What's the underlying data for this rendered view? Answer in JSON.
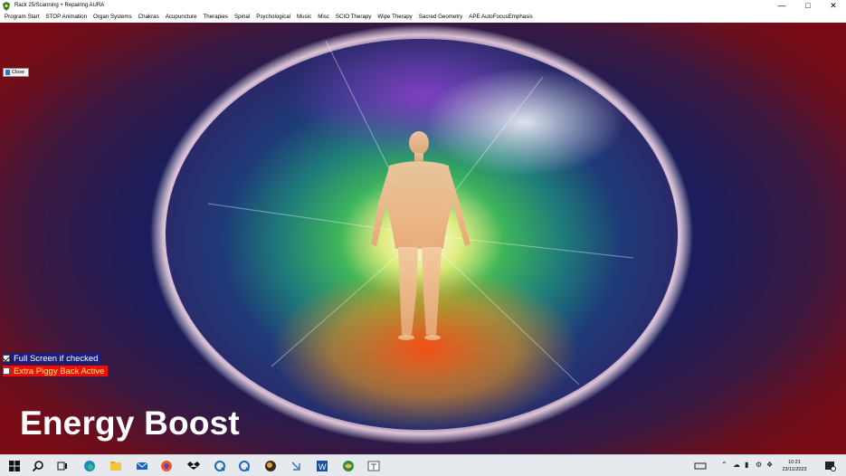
{
  "window": {
    "title": "Rack 25/Scanning + Repairing AURA",
    "controls": {
      "minimize": "—",
      "maximize": "□",
      "close": "✕"
    }
  },
  "menu": {
    "items": [
      "Program Start",
      "STOP Animation",
      "Organ Systems",
      "Chakras",
      "Acupuncture",
      "Therapies",
      "Spinal",
      "Psychological",
      "Music",
      "Misc",
      "SCIO Therapy",
      "Wipe Therapy",
      "Sacred Geometry",
      "APE AutoFocusEmphasis"
    ]
  },
  "main": {
    "close_button_label": "Close",
    "fullscreen_checkbox": {
      "label": "Full Screen if checked",
      "checked": true
    },
    "piggyback_checkbox": {
      "label": "Extra Piggy Back Active",
      "checked": false
    },
    "caption": "Energy Boost"
  },
  "taskbar": {
    "icons": [
      "windows-start-icon",
      "search-icon",
      "task-view-icon",
      "edge-icon",
      "file-explorer-icon",
      "mail-icon",
      "firefox-icon",
      "dropbox-icon",
      "app-q-icon",
      "app-q2-icon",
      "app-ball-icon",
      "app-arrow-icon",
      "word-icon",
      "app-globe-icon",
      "app-window-icon"
    ],
    "clock_time": "10:21",
    "clock_date": "23/11/2023"
  },
  "colors": {
    "aura_outer": "#7a0b14",
    "aura_inner": "#1c1d5a",
    "fullscreen_bg": "#1a1d7a",
    "piggyback_bg": "#e81010",
    "piggyback_text": "#ffef6a"
  }
}
